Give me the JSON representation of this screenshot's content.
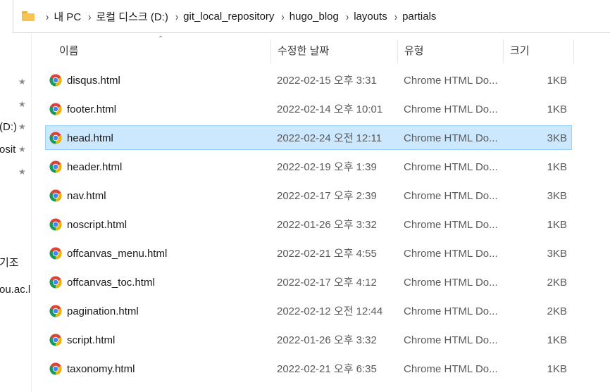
{
  "breadcrumb": {
    "items": [
      "내 PC",
      "로컬 디스크 (D:)",
      "git_local_repository",
      "hugo_blog",
      "layouts",
      "partials"
    ],
    "separator": "›"
  },
  "nav": {
    "items": [
      "(D:)",
      "osit",
      "기조",
      "ou.ac.l"
    ]
  },
  "columns": {
    "name": "이름",
    "date": "수정한 날짜",
    "type": "유형",
    "size": "크기"
  },
  "files": [
    {
      "name": "disqus.html",
      "date": "2022-02-15 오후 3:31",
      "type": "Chrome HTML Do...",
      "size": "1KB",
      "selected": false
    },
    {
      "name": "footer.html",
      "date": "2022-02-14 오후 10:01",
      "type": "Chrome HTML Do...",
      "size": "1KB",
      "selected": false
    },
    {
      "name": "head.html",
      "date": "2022-02-24 오전 12:11",
      "type": "Chrome HTML Do...",
      "size": "3KB",
      "selected": true
    },
    {
      "name": "header.html",
      "date": "2022-02-19 오후 1:39",
      "type": "Chrome HTML Do...",
      "size": "1KB",
      "selected": false
    },
    {
      "name": "nav.html",
      "date": "2022-02-17 오후 2:39",
      "type": "Chrome HTML Do...",
      "size": "3KB",
      "selected": false
    },
    {
      "name": "noscript.html",
      "date": "2022-01-26 오후 3:32",
      "type": "Chrome HTML Do...",
      "size": "1KB",
      "selected": false
    },
    {
      "name": "offcanvas_menu.html",
      "date": "2022-02-21 오후 4:55",
      "type": "Chrome HTML Do...",
      "size": "3KB",
      "selected": false
    },
    {
      "name": "offcanvas_toc.html",
      "date": "2022-02-17 오후 4:12",
      "type": "Chrome HTML Do...",
      "size": "2KB",
      "selected": false
    },
    {
      "name": "pagination.html",
      "date": "2022-02-12 오전 12:44",
      "type": "Chrome HTML Do...",
      "size": "2KB",
      "selected": false
    },
    {
      "name": "script.html",
      "date": "2022-01-26 오후 3:32",
      "type": "Chrome HTML Do...",
      "size": "1KB",
      "selected": false
    },
    {
      "name": "taxonomy.html",
      "date": "2022-02-21 오후 6:35",
      "type": "Chrome HTML Do...",
      "size": "1KB",
      "selected": false
    }
  ],
  "icons": {
    "folder": "folder-icon",
    "file": "chrome-html-icon",
    "pin": "pin-icon"
  },
  "colors": {
    "selection_bg": "#cce8ff",
    "selection_border": "#99d1ff",
    "folder": "#f5c451"
  }
}
